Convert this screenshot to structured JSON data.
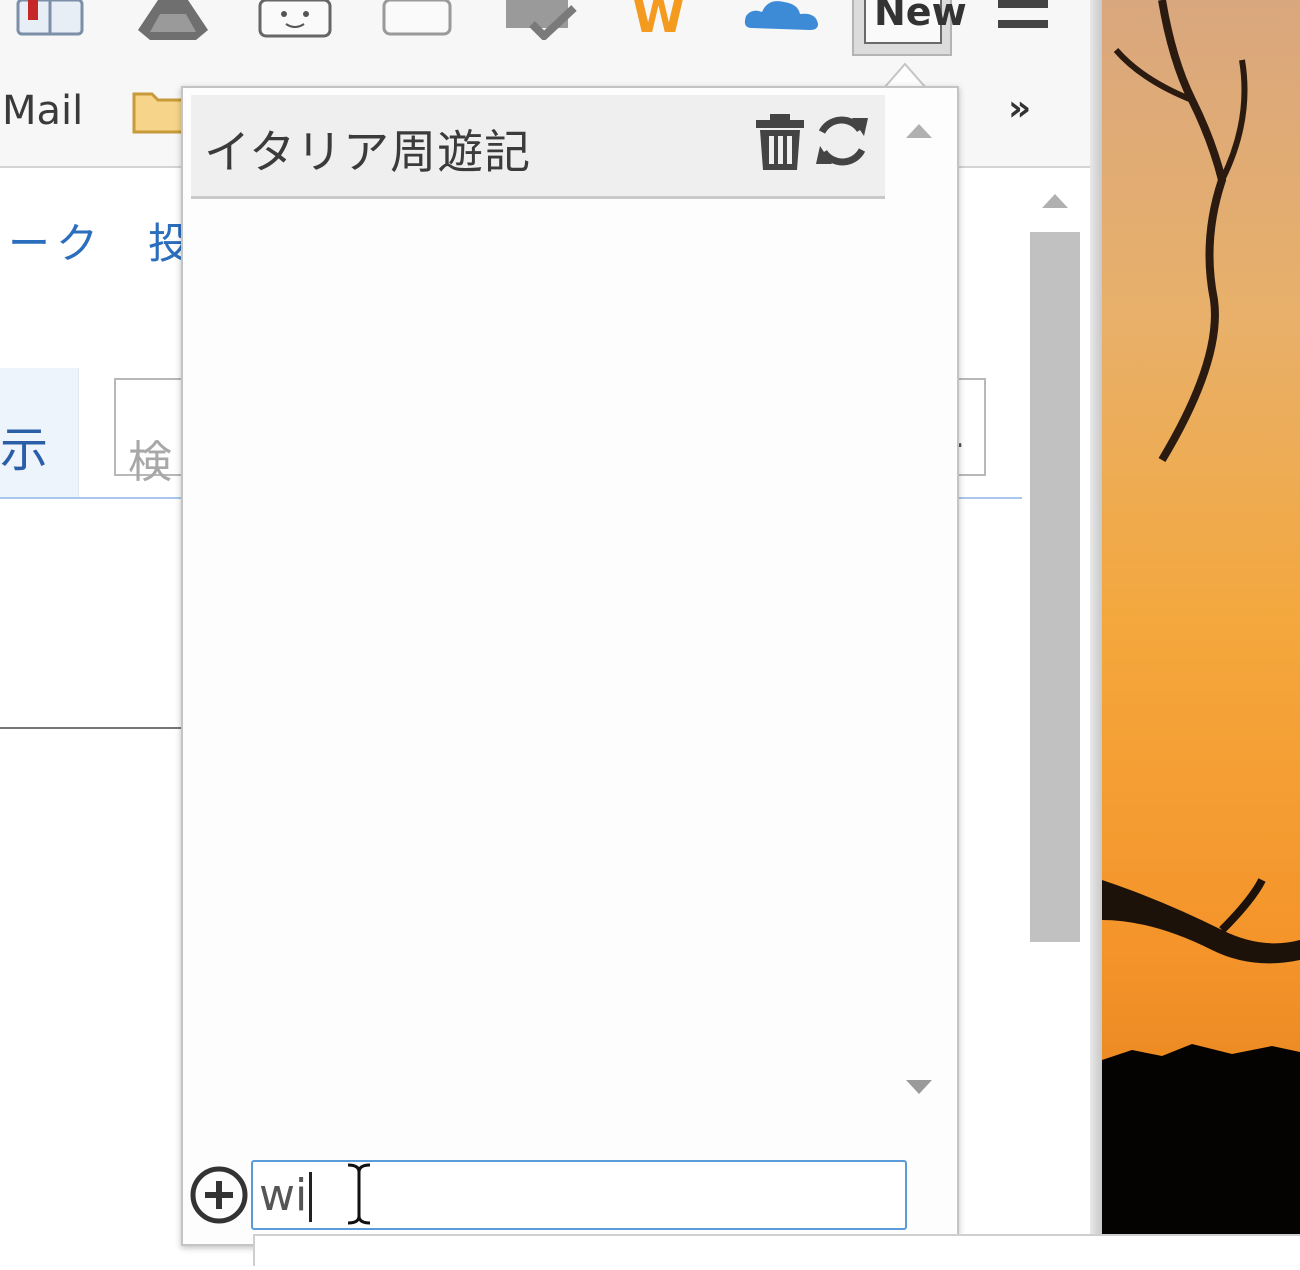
{
  "toolbar": {
    "icons": [
      "bookmark-book-icon",
      "drive-icon",
      "face-app-icon",
      "blank-tab-icon",
      "mail-check-icon",
      "w-app-icon",
      "cloud-icon",
      "new-note-extension-icon",
      "menu-icon"
    ],
    "new_badge": "New",
    "w_letter": "W"
  },
  "bookmarks": {
    "mail_label": "Mail",
    "more_label": "»"
  },
  "page": {
    "nav_text": "ーク",
    "nav_text2": "投",
    "tab_text": "示",
    "search_placeholder": "検",
    "search_right_char": "."
  },
  "popup": {
    "note_title": "イタリア周遊記",
    "new_note_value": "wi"
  },
  "colors": {
    "accent_blue": "#5b9bd9",
    "link_blue": "#2a6ebd",
    "sunset_orange": "#f29a3a"
  }
}
